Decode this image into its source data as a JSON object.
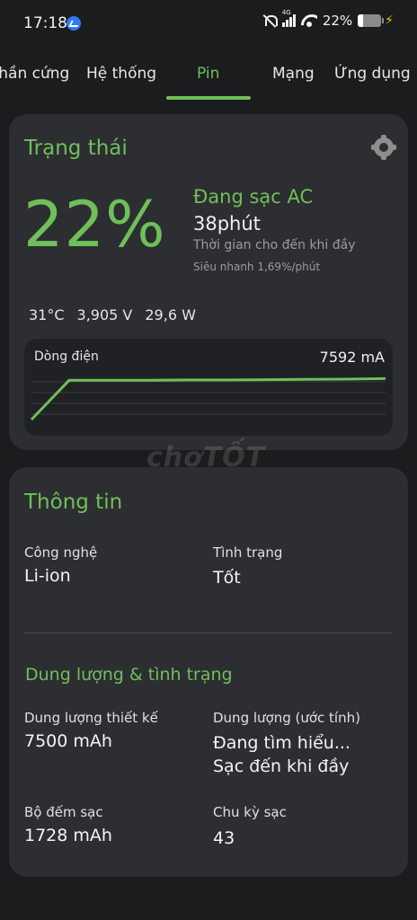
{
  "status_bar": {
    "time": "17:18",
    "network_type": "4G",
    "battery_percent": "22%",
    "battery_level": 0.22,
    "icons": [
      "messenger-icon",
      "mute-icon",
      "signal-icon",
      "wifi-icon",
      "battery-icon",
      "charging-bolt-icon"
    ]
  },
  "tabs": {
    "items": [
      {
        "label": "Phần cứng"
      },
      {
        "label": "Hệ thống"
      },
      {
        "label": "Pin"
      },
      {
        "label": "Mạng"
      },
      {
        "label": "Ứng dụng"
      }
    ],
    "active": "Pin"
  },
  "status_card": {
    "title": "Trạng thái",
    "percent": "22%",
    "charge_state": "Đang sạc AC",
    "time_remaining": "38phút",
    "time_caption": "Thời gian cho đến khi đầy",
    "charge_rate": "Siêu nhanh 1,69%/phút",
    "temperature": "31°C",
    "voltage": "3,905 V",
    "power": "29,6 W",
    "current": {
      "label": "Dòng điện",
      "value": "7592 mA"
    }
  },
  "chart_data": {
    "type": "line",
    "title": "",
    "xlabel": "",
    "ylabel": "",
    "series": [
      {
        "values": [
          0,
          7300,
          7300,
          7300,
          7350,
          7350,
          7400,
          7450,
          7500,
          7592
        ]
      }
    ],
    "ylim": [
      0,
      9000
    ],
    "grid": true
  },
  "info_card": {
    "title": "Thông tin",
    "technology_label": "Công nghệ",
    "technology_value": "Li-ion",
    "health_label": "Tình trạng",
    "health_value": "Tốt",
    "capacity_section_title": "Dung lượng & tình trạng",
    "design_capacity_label": "Dung lượng thiết kế",
    "design_capacity_value": "7500 mAh",
    "estimated_capacity_label": "Dung lượng (ước tính)",
    "estimated_capacity_value_line1": "Đang tìm hiểu...",
    "estimated_capacity_value_line2": "Sạc đến khi đầy",
    "charge_counter_label": "Bộ đếm sạc",
    "charge_counter_value": "1728 mAh",
    "charge_cycles_label": "Chu kỳ sạc",
    "charge_cycles_value": "43"
  },
  "watermark": "chợTỐT",
  "colors": {
    "accent": "#6fbf5a",
    "background": "#1b1c1e",
    "card": "#2d2e31"
  }
}
